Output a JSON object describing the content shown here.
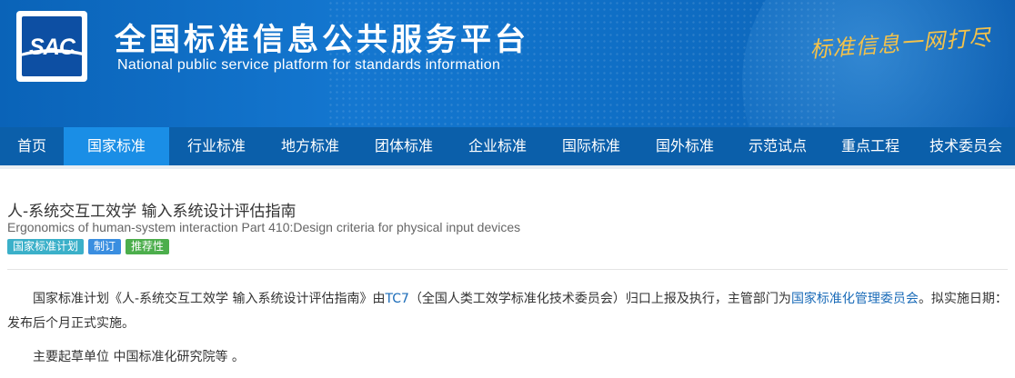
{
  "header": {
    "logo_text": "SAC",
    "title_cn": "全国标准信息公共服务平台",
    "title_en": "National public service platform  for standards information",
    "slogan": "标准信息一网打尽"
  },
  "nav": {
    "items": [
      {
        "label": "首页"
      },
      {
        "label": "国家标准"
      },
      {
        "label": "行业标准"
      },
      {
        "label": "地方标准"
      },
      {
        "label": "团体标准"
      },
      {
        "label": "企业标准"
      },
      {
        "label": "国际标准"
      },
      {
        "label": "国外标准"
      },
      {
        "label": "示范试点"
      },
      {
        "label": "重点工程"
      },
      {
        "label": "技术委员会"
      }
    ],
    "active_index": 1
  },
  "standard": {
    "title_cn": "人-系统交互工效学 输入系统设计评估指南",
    "title_en": "Ergonomics of human-system interaction Part 410:Design criteria for physical input devices",
    "tags": [
      {
        "label": "国家标准计划",
        "color": "#3bb0c9"
      },
      {
        "label": "制订",
        "color": "#3a8ee0"
      },
      {
        "label": "推荐性",
        "color": "#4cae4c"
      }
    ],
    "description": {
      "prefix": "国家标准计划《人-系统交互工效学 输入系统设计评估指南》由",
      "tc_link": "TC7",
      "middle": "（全国人类工效学标准化技术委员会）归口上报及执行，主管部门为",
      "dept_link": "国家标准化管理委员会",
      "suffix": "。拟实施日期：发布后个月正式实施。"
    },
    "drafting_units": "主要起草单位 中国标准化研究院等 。"
  },
  "colors": {
    "banner": "#1477d0",
    "nav_bg": "#0b5faa",
    "nav_active": "#1a8ee6",
    "link": "#1a6bb8"
  }
}
